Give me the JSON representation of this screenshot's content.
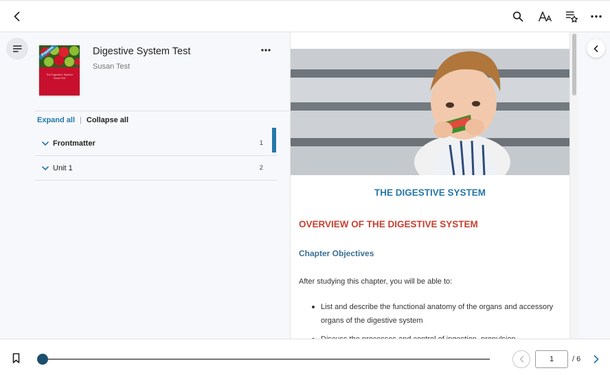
{
  "header": {
    "icons": [
      "back-arrow-icon",
      "search-icon",
      "text-size-icon",
      "add-to-favorites-icon",
      "more-icon"
    ]
  },
  "book": {
    "title": "Digestive System Test",
    "author": "Susan Test",
    "cover_badge": "Preview",
    "cover_title": "The Digestive System",
    "cover_author": "Susan Test"
  },
  "toc": {
    "expand_all": "Expand all",
    "separator": "|",
    "collapse_all": "Collapse all",
    "items": [
      {
        "label": "Frontmatter",
        "page": "1",
        "active": true
      },
      {
        "label": "Unit 1",
        "page": "2",
        "active": false
      }
    ]
  },
  "content": {
    "heading": "THE DIGESTIVE SYSTEM",
    "overview": "OVERVIEW OF THE DIGESTIVE SYSTEM",
    "objectives_heading": "Chapter Objectives",
    "intro": "After studying this chapter, you will be able to:",
    "bullets": [
      "List and describe the functional anatomy of the organs and accessory organs of the digestive system",
      "Discuss the processes and control of ingestion, propulsion"
    ]
  },
  "footer": {
    "current_page": "1",
    "total_pages": "/ 6",
    "progress_fraction": 0
  },
  "colors": {
    "accent_blue": "#2577a9",
    "heading_red": "#c8402f",
    "slider_knob": "#1c4f6e",
    "cover_red": "#c8102e"
  }
}
